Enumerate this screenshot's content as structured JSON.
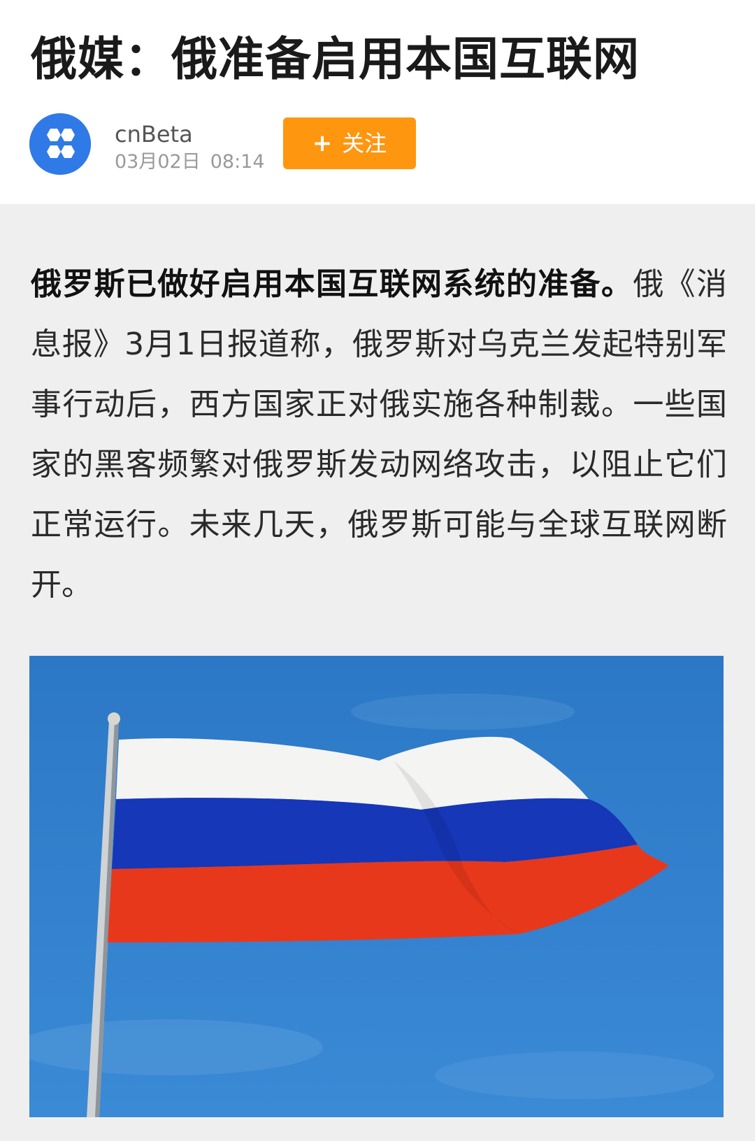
{
  "article": {
    "title": "俄媒：俄准备启用本国互联网",
    "author": "cnBeta",
    "date": "03月02日",
    "time": "08:14",
    "follow_plus": "+",
    "follow_label": "关注",
    "lead": "俄罗斯已做好启用本国互联网系统的准备。",
    "body": "俄《消息报》3月1日报道称，俄罗斯对乌克兰发起特别军事行动后，西方国家正对俄实施各种制裁。一些国家的黑客频繁对俄罗斯发动网络攻击，以阻止它们正常运行。未来几天，俄罗斯可能与全球互联网断开。"
  },
  "image": {
    "subject": "russian-flag",
    "colors": {
      "sky": "#2f7fc8",
      "white": "#f4f4f2",
      "blue": "#1537b8",
      "red": "#e8381c"
    }
  },
  "colors": {
    "accent": "#ff9610",
    "avatar": "#2f7ae6"
  }
}
